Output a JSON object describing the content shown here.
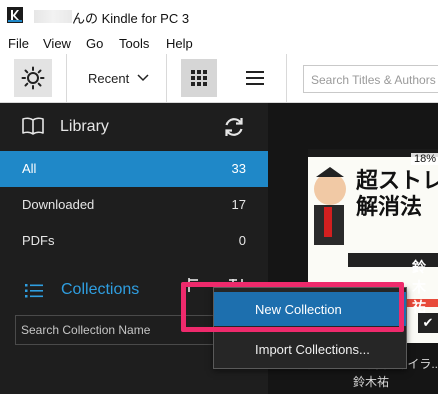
{
  "window": {
    "title": "んの Kindle for PC 3"
  },
  "menu": [
    "File",
    "View",
    "Go",
    "Tools",
    "Help"
  ],
  "toolbar": {
    "sort_label": "Recent",
    "search_placeholder": "Search Titles & Authors"
  },
  "sidebar": {
    "library_title": "Library",
    "nav": [
      {
        "label": "All",
        "count": "33",
        "active": true
      },
      {
        "label": "Downloaded",
        "count": "17",
        "active": false
      },
      {
        "label": "PDFs",
        "count": "0",
        "active": false
      }
    ],
    "collections_title": "Collections",
    "collection_search_placeholder": "Search Collection Name"
  },
  "context_menu": {
    "items": [
      "New Collection",
      "Import Collections..."
    ]
  },
  "book": {
    "progress": "18%",
    "cover_text": "超ストレス解消法",
    "cover_author": "鈴木祐",
    "title": "超ストレス解消法 イラ...",
    "author": "鈴木祐",
    "downloaded_check": "✔"
  },
  "colors": {
    "accent": "#1f88c8",
    "collections_accent": "#2f9ee0",
    "highlight_frame": "#ee2a6c",
    "menu_highlight": "#1d6fae"
  },
  "icons": [
    "kindle-app-icon",
    "brightness-icon",
    "chevron-down-icon",
    "grid-view-icon",
    "list-view-icon",
    "book-icon",
    "sync-icon",
    "collections-list-icon",
    "add-icon",
    "sort-icon",
    "checkmark-icon"
  ]
}
